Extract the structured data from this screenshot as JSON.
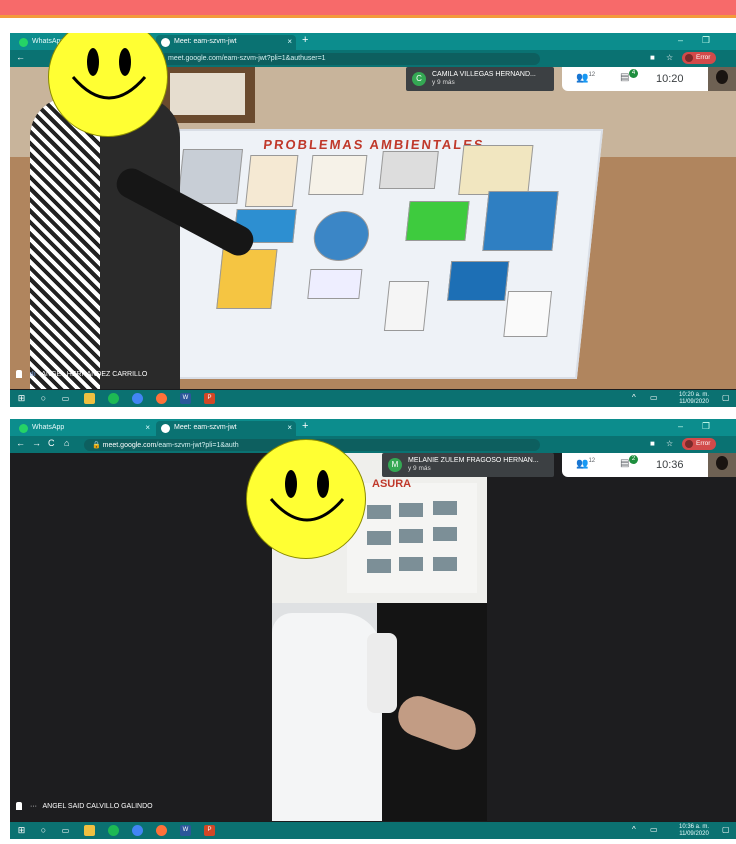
{
  "screens": [
    {
      "tabs": [
        {
          "label": "WhatsApp",
          "icon": "whatsapp-icon"
        },
        {
          "label": "Meet: eam-szvm-jwt",
          "icon": "meet-icon"
        }
      ],
      "url": "meet.google.com/eam-szvm-jwt?pli=1&authuser=1",
      "error_label": "Error",
      "participant_name": "CAMILA VILLEGAS HERNAND...",
      "participant_initial": "C",
      "participant_more": "y 9 más",
      "people_count": "12",
      "chat_badge": "4",
      "time": "10:20",
      "presenter_name": "ANGEL HERNANDEZ CARRILLO",
      "poster_title": "PROBLEMAS   AMBIENTALES",
      "tray_time": "10:20 a. m.",
      "tray_date": "11/09/2020"
    },
    {
      "tabs": [
        {
          "label": "WhatsApp",
          "icon": "whatsapp-icon"
        },
        {
          "label": "Meet: eam-szvm-jwt",
          "icon": "meet-icon"
        }
      ],
      "url_host": "meet.google.com",
      "url_path": "/eam-szvm-jwt?pli=1&auth",
      "error_label": "Error",
      "participant_name": "MELANIE ZULEM FRAGOSO HERNAN...",
      "participant_initial": "M",
      "participant_more": "y 9 más",
      "people_count": "12",
      "chat_badge": "2",
      "time": "10:36",
      "presenter_name": "ANGEL SAID CALVILLO GALINDO",
      "wall_text": "ASURA",
      "tray_time": "10:36 a. m.",
      "tray_date": "11/09/2020"
    }
  ]
}
